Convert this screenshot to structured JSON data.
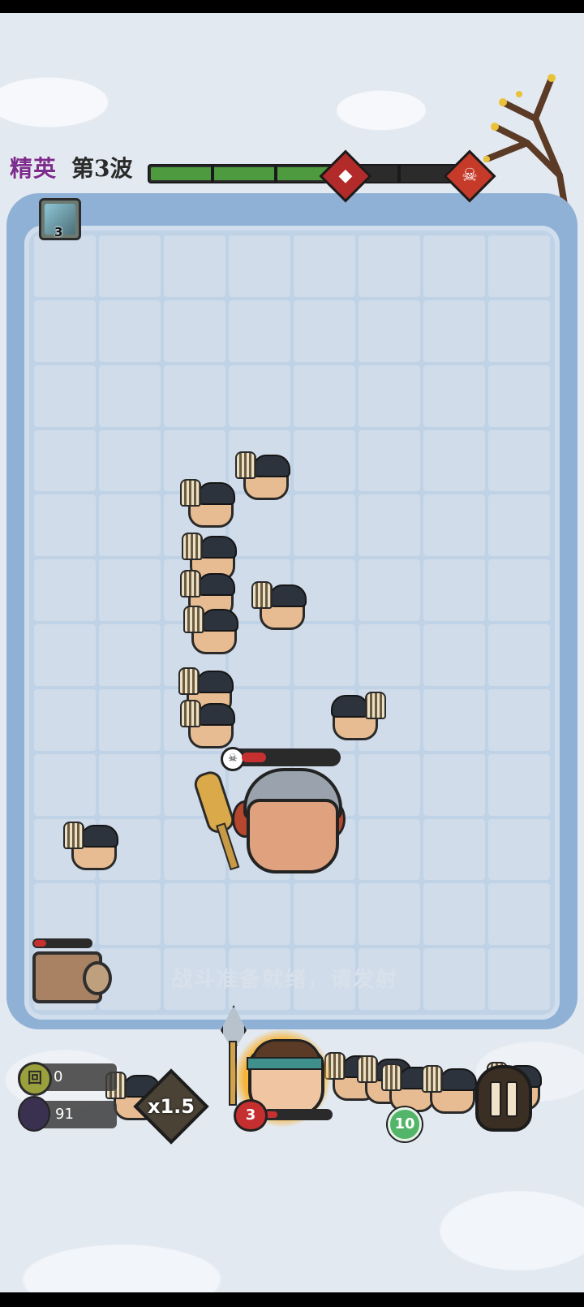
{
  "header": {
    "difficulty_label": "精英",
    "wave_label": "第3波",
    "wave_progress_fraction": 0.55,
    "mid_marker_icon": "elite-diamond-icon",
    "boss_marker_icon": "boss-skull-icon"
  },
  "buff": {
    "icon": "ice-lightning-icon",
    "count": "3"
  },
  "battlefield": {
    "status_text": "战斗准备就绪，请发射",
    "boss_hp_fraction": 0.25,
    "cart_hp_fraction": 0.22,
    "grid_columns": 8,
    "grid_rows": 12
  },
  "hud": {
    "coins": "0",
    "kills": "91",
    "speed_label": "x1.5",
    "hero_hp": "3",
    "hero_hp_fraction": 0.2,
    "ammo": "10",
    "coin_icon": "coin-icon",
    "kill_icon": "ninja-icon",
    "pause_icon": "pause-icon"
  },
  "colors": {
    "difficulty": "#7c2c8c",
    "progress": "#4e9a3e",
    "hp": "#c73030",
    "ammo": "#53b56a"
  }
}
